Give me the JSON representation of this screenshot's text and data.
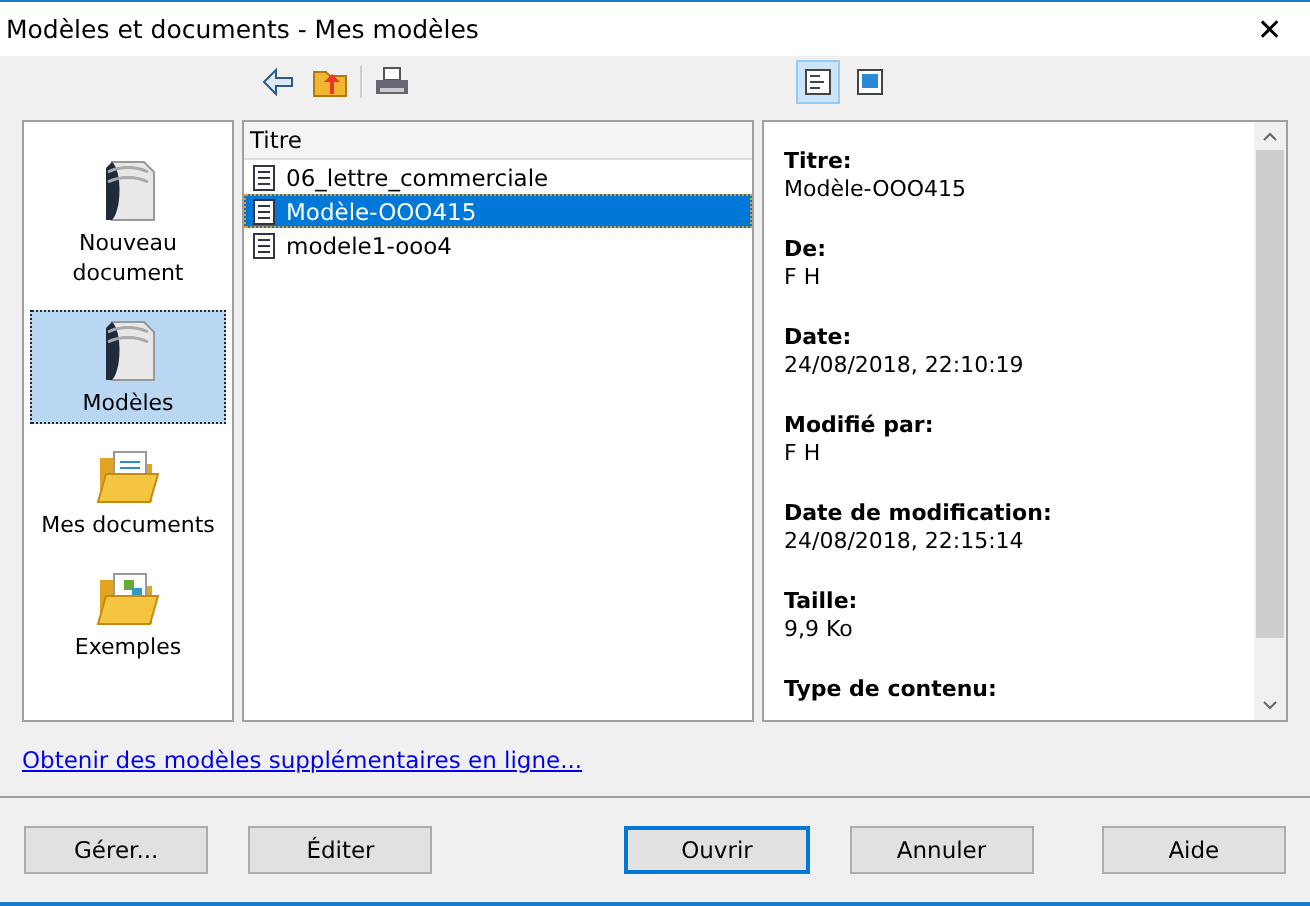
{
  "window": {
    "title": "Modèles et documents - Mes modèles",
    "close": "✕"
  },
  "toolbar": {
    "views": [
      {
        "kind": "details",
        "selected": true
      },
      {
        "kind": "preview",
        "selected": false
      }
    ]
  },
  "categories": [
    {
      "kind": "template",
      "label": "Nouveau document",
      "selected": false
    },
    {
      "kind": "template",
      "label": "Modèles",
      "selected": true
    },
    {
      "kind": "folder",
      "label": "Mes documents",
      "selected": false
    },
    {
      "kind": "examples",
      "label": "Exemples",
      "selected": false
    }
  ],
  "file_list": {
    "column": "Titre",
    "rows": [
      {
        "name": "06_lettre_commerciale",
        "selected": false
      },
      {
        "name": "Modèle-OOO415",
        "selected": true
      },
      {
        "name": "modele1-ooo4",
        "selected": false
      }
    ]
  },
  "properties": [
    {
      "label": "Titre:",
      "value": "Modèle-OOO415"
    },
    {
      "label": "De:",
      "value": "F H"
    },
    {
      "label": "Date:",
      "value": "24/08/2018, 22:10:19"
    },
    {
      "label": "Modifié par:",
      "value": "F H"
    },
    {
      "label": "Date de modification:",
      "value": "24/08/2018, 22:15:14"
    },
    {
      "label": "Taille:",
      "value": "9,9 Ko"
    },
    {
      "label": "Type de contenu:"
    }
  ],
  "link": "Obtenir des modèles supplémentaires en ligne...",
  "buttons": [
    {
      "label": "Gérer...",
      "default": false
    },
    {
      "label": "Éditer",
      "default": false
    },
    {
      "label": "Ouvrir",
      "default": true
    },
    {
      "label": "Annuler",
      "default": false
    },
    {
      "label": "Aide",
      "default": false
    }
  ]
}
